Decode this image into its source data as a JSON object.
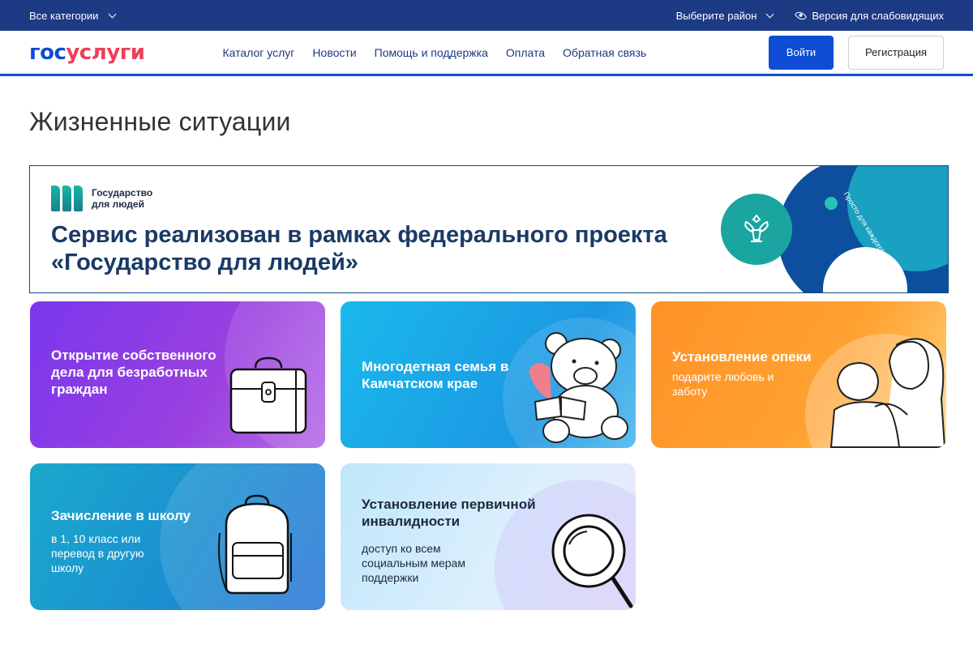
{
  "topbar": {
    "categories_label": "Все категории",
    "region_label": "Выберите район",
    "accessibility_label": "Версия для слабовидящих"
  },
  "header": {
    "logo_part1": "гос",
    "logo_part2": "услуги",
    "nav": [
      "Каталог услуг",
      "Новости",
      "Помощь и поддержка",
      "Оплата",
      "Обратная связь"
    ],
    "login_label": "Войти",
    "register_label": "Регистрация"
  },
  "page_title": "Жизненные ситуации",
  "banner": {
    "project_name": "Государство для людей",
    "title": "Сервис реализован в рамках федерального проекта «Государство для людей»",
    "slogan": "Просто для каждого!"
  },
  "cards": [
    {
      "title": "Открытие собственного дела для безработных граждан",
      "subtitle": "",
      "icon": "briefcase-icon"
    },
    {
      "title": "Многодетная семья в Камчатском крае",
      "subtitle": "",
      "icon": "teddy-bear-icon"
    },
    {
      "title": "Установление опеки",
      "subtitle": "подарите любовь и заботу",
      "icon": "mother-child-icon"
    },
    {
      "title": "Зачисление в школу",
      "subtitle": "в 1, 10 класс или перевод в другую школу",
      "icon": "backpack-icon"
    },
    {
      "title": "Установление первичной инвалидности",
      "subtitle": "доступ ко всем социальным мерам поддержки",
      "icon": "magnifier-icon"
    }
  ],
  "colors": {
    "topbar": "#1d3a84",
    "brand_blue": "#0d4cd3",
    "brand_red": "#ee3f58",
    "card_purple": "#8b3ee8",
    "card_cyan": "#1aa7e8",
    "card_orange": "#ff9a2c",
    "card_blue": "#1b8fd0",
    "card_light": "#d6ecfb"
  }
}
